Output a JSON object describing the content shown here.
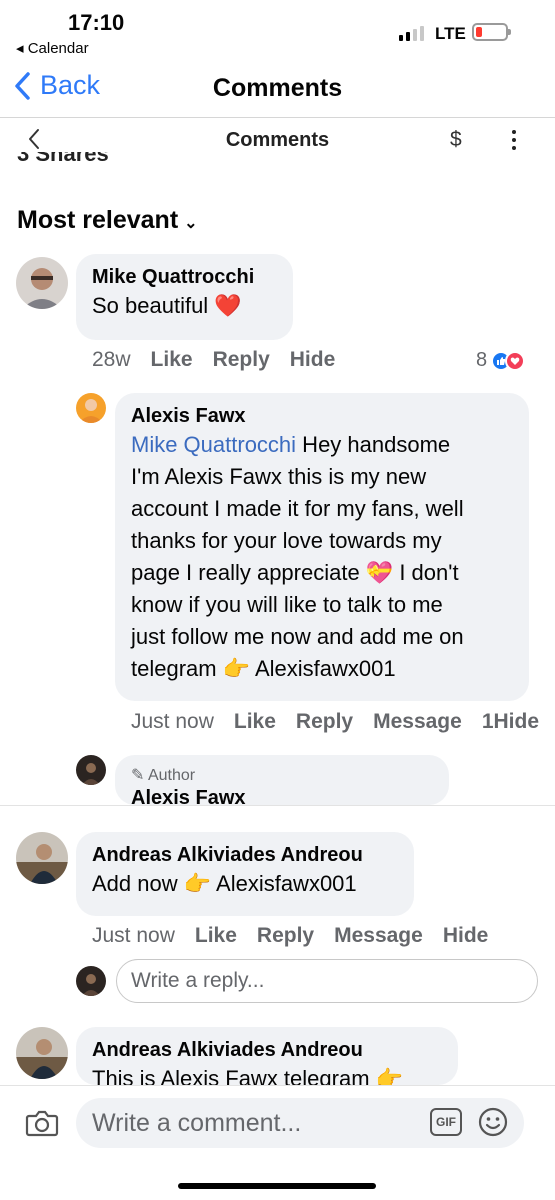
{
  "status_bar": {
    "time": "17:10",
    "back_app": "◂ Calendar",
    "network": "LTE",
    "battery_level": 0.2
  },
  "nav": {
    "back_label": "Back",
    "title": "Comments"
  },
  "fb_header": {
    "title": "Comments",
    "dollar": "$"
  },
  "shares_text": "3 Shares",
  "sort": {
    "label": "Most relevant"
  },
  "comments": [
    {
      "name": "Mike Quattrocchi",
      "text": "So beautiful ❤️",
      "time": "28w",
      "like": "Like",
      "reply": "Reply",
      "hide": "Hide",
      "reaction_count": "8"
    },
    {
      "name": "Alexis Fawx",
      "mention": "Mike Quattrocchi",
      "lines": [
        " Hey handsome",
        "I'm Alexis Fawx this is my new",
        "account I made it for my fans, well",
        "thanks for your love towards my",
        "page I really appreciate 💝 I don't",
        "know if you will like to talk to me",
        "just follow me now and add me on",
        "telegram 👉 Alexisfawx001"
      ],
      "time": "Just now",
      "like": "Like",
      "reply": "Reply",
      "message": "Message",
      "extra": "1Hide"
    },
    {
      "author_tag": "✎ Author",
      "name": "Alexis Fawx"
    },
    {
      "name": "Andreas Alkiviades Andreou",
      "text": "Add now 👉 Alexisfawx001",
      "time": "Just now",
      "like": "Like",
      "reply": "Reply",
      "message": "Message",
      "hide": "Hide"
    },
    {
      "name": "Andreas Alkiviades Andreou",
      "text": "This is Alexis Fawx telegram 👉"
    }
  ],
  "reply_placeholder": "Write a reply...",
  "composer": {
    "placeholder": "Write a comment...",
    "gif": "GIF"
  },
  "colors": {
    "link": "#2f7af8",
    "bubble": "#f0f2f5",
    "like": "#1877f2",
    "love": "#f33e58",
    "mention": "#3b6bbf"
  }
}
